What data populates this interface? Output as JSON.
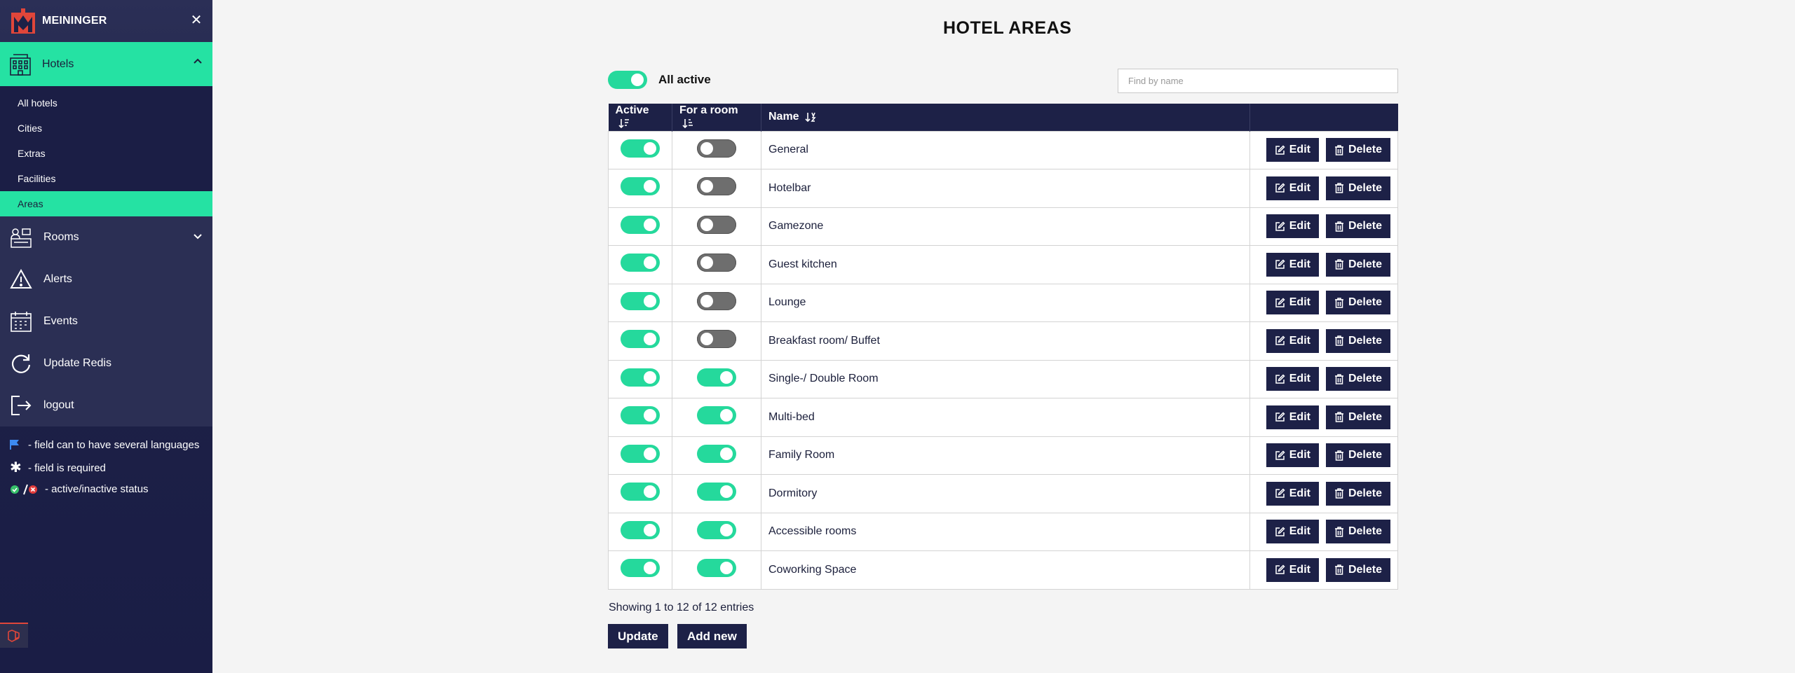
{
  "sidebar": {
    "brand": "MEININGER",
    "close_icon": "close-icon",
    "hotels": {
      "label": "Hotels",
      "icon": "hotel-icon"
    },
    "subitems": [
      {
        "label": "All hotels"
      },
      {
        "label": "Cities"
      },
      {
        "label": "Extras"
      },
      {
        "label": "Facilities"
      },
      {
        "label": "Areas"
      }
    ],
    "nav": [
      {
        "label": "Rooms",
        "icon": "reception-icon"
      },
      {
        "label": "Alerts",
        "icon": "warning-icon"
      },
      {
        "label": "Events",
        "icon": "calendar-icon"
      },
      {
        "label": "Update Redis",
        "icon": "refresh-icon"
      },
      {
        "label": "logout",
        "icon": "logout-icon"
      }
    ],
    "legend": [
      {
        "text": "- field can to have several languages",
        "icon": "flag-icon"
      },
      {
        "text": "- field is required",
        "icon": "asterisk-icon"
      },
      {
        "text": "- active/inactive status",
        "icon": "status-icon"
      }
    ]
  },
  "page": {
    "title": "HOTEL AREAS",
    "all_active_label": "All active",
    "search_placeholder": "Find by name",
    "entries_text": "Showing 1 to 12 of 12 entries",
    "update_label": "Update",
    "add_new_label": "Add new",
    "colors": {
      "accent": "#25e2a3",
      "navy": "#1d2147"
    }
  },
  "table": {
    "headers": {
      "active": "Active",
      "for_room": "For a room",
      "name": "Name"
    },
    "edit_label": "Edit",
    "delete_label": "Delete",
    "rows": [
      {
        "name": "General",
        "active": true,
        "for_room": false
      },
      {
        "name": "Hotelbar",
        "active": true,
        "for_room": false
      },
      {
        "name": "Gamezone",
        "active": true,
        "for_room": false
      },
      {
        "name": "Guest kitchen",
        "active": true,
        "for_room": false
      },
      {
        "name": "Lounge",
        "active": true,
        "for_room": false
      },
      {
        "name": "Breakfast room/ Buffet",
        "active": true,
        "for_room": false
      },
      {
        "name": "Single-/ Double Room",
        "active": true,
        "for_room": true
      },
      {
        "name": "Multi-bed",
        "active": true,
        "for_room": true
      },
      {
        "name": "Family Room",
        "active": true,
        "for_room": true
      },
      {
        "name": "Dormitory",
        "active": true,
        "for_room": true
      },
      {
        "name": "Accessible rooms",
        "active": true,
        "for_room": true
      },
      {
        "name": "Coworking Space",
        "active": true,
        "for_room": true
      }
    ]
  }
}
